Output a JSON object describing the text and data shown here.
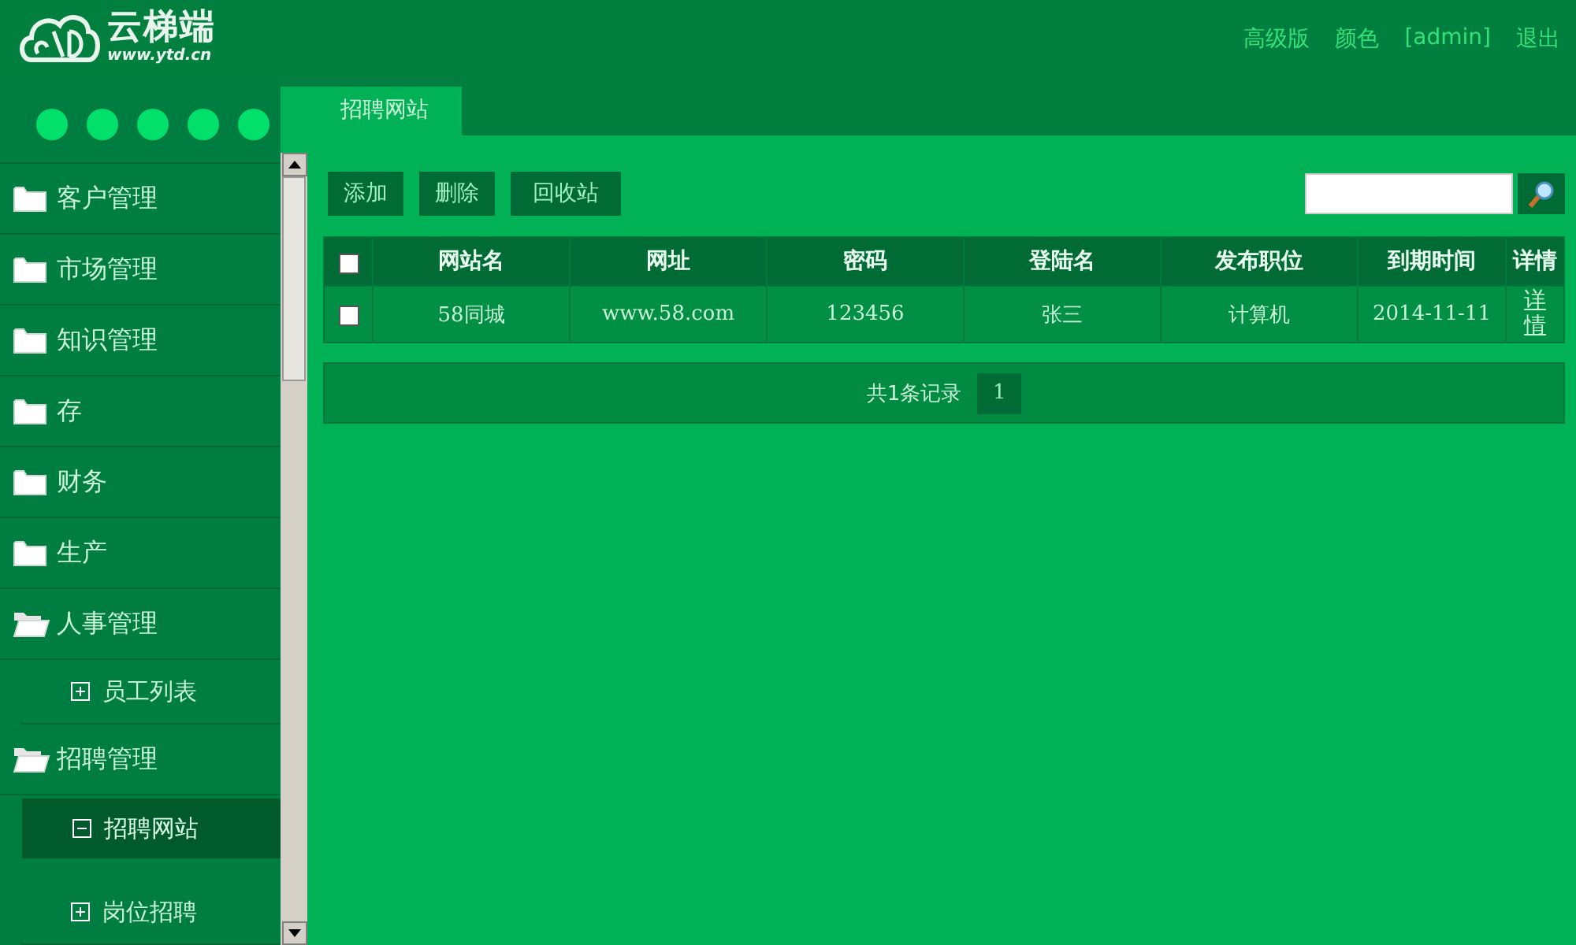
{
  "header": {
    "logo_text": "云梯端",
    "logo_url": "www.ytd.cn",
    "links": [
      "高级版",
      "颜色",
      "[admin]",
      "退出"
    ]
  },
  "sidebar": {
    "theme_dots": [
      {
        "color": "#00e06a"
      },
      {
        "color": "#00e06a"
      },
      {
        "color": "#00e06a"
      },
      {
        "color": "#00e06a"
      },
      {
        "color": "#00e06a"
      }
    ],
    "items": [
      {
        "label": "客户管理",
        "expanded": false
      },
      {
        "label": "市场管理",
        "expanded": false
      },
      {
        "label": "知识管理",
        "expanded": false
      },
      {
        "label": "存",
        "expanded": false
      },
      {
        "label": "财务",
        "expanded": false
      },
      {
        "label": "生产",
        "expanded": false
      },
      {
        "label": "人事管理",
        "expanded": true,
        "children": [
          {
            "label": "员工列表",
            "selected": false
          }
        ]
      },
      {
        "label": "招聘管理",
        "expanded": true,
        "children": [
          {
            "label": "招聘网站",
            "selected": true
          },
          {
            "label": "岗位招聘",
            "selected": false
          }
        ]
      }
    ]
  },
  "tabs": [
    {
      "label": "招聘网站",
      "selected": true
    }
  ],
  "toolbar": {
    "buttons": [
      "添加",
      "删除",
      "回收站"
    ]
  },
  "table": {
    "columns": [
      "网站名",
      "网址",
      "密码",
      "登陆名",
      "发布职位",
      "到期时间",
      "详情"
    ],
    "rows": [
      {
        "checked": false,
        "cells": [
          "58同城",
          "www.58.com",
          "123456",
          "张三",
          "计算机",
          "2014-11-11",
          "详情"
        ]
      }
    ],
    "header_checked": false
  },
  "pagination": {
    "summary": "共1条记录",
    "pages": [
      {
        "label": "1",
        "selected": true
      }
    ]
  }
}
